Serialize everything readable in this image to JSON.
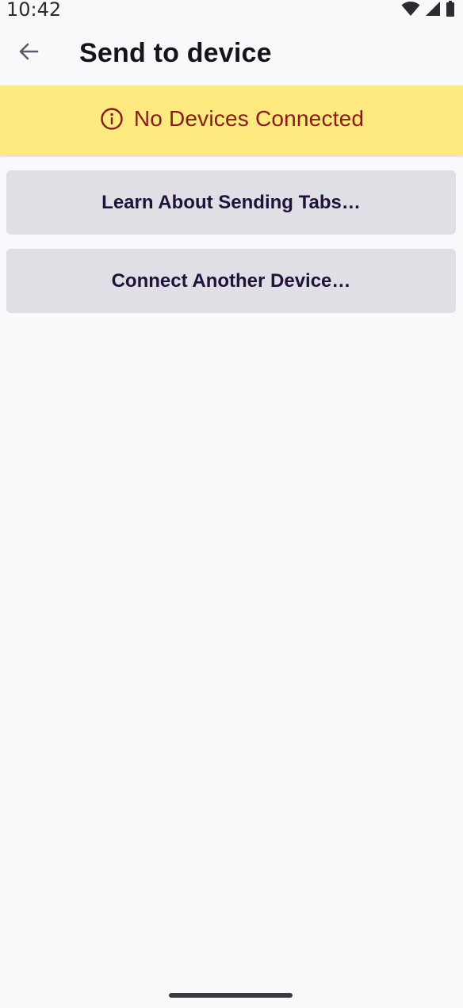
{
  "status_bar": {
    "time": "10:42",
    "icons": [
      "wifi-icon",
      "cellular-signal-icon",
      "battery-icon"
    ]
  },
  "app_bar": {
    "back_icon": "arrow-back-icon",
    "title": "Send to device"
  },
  "banner": {
    "icon": "info-icon",
    "text": "No Devices Connected",
    "background_color": "#ffea80",
    "text_color": "#8a1a14"
  },
  "buttons": {
    "learn": "Learn About Sending Tabs…",
    "connect": "Connect Another Device…"
  },
  "colors": {
    "button_bg": "#e0dfe6",
    "button_text": "#20123a",
    "page_bg": "#f9f9fb"
  }
}
